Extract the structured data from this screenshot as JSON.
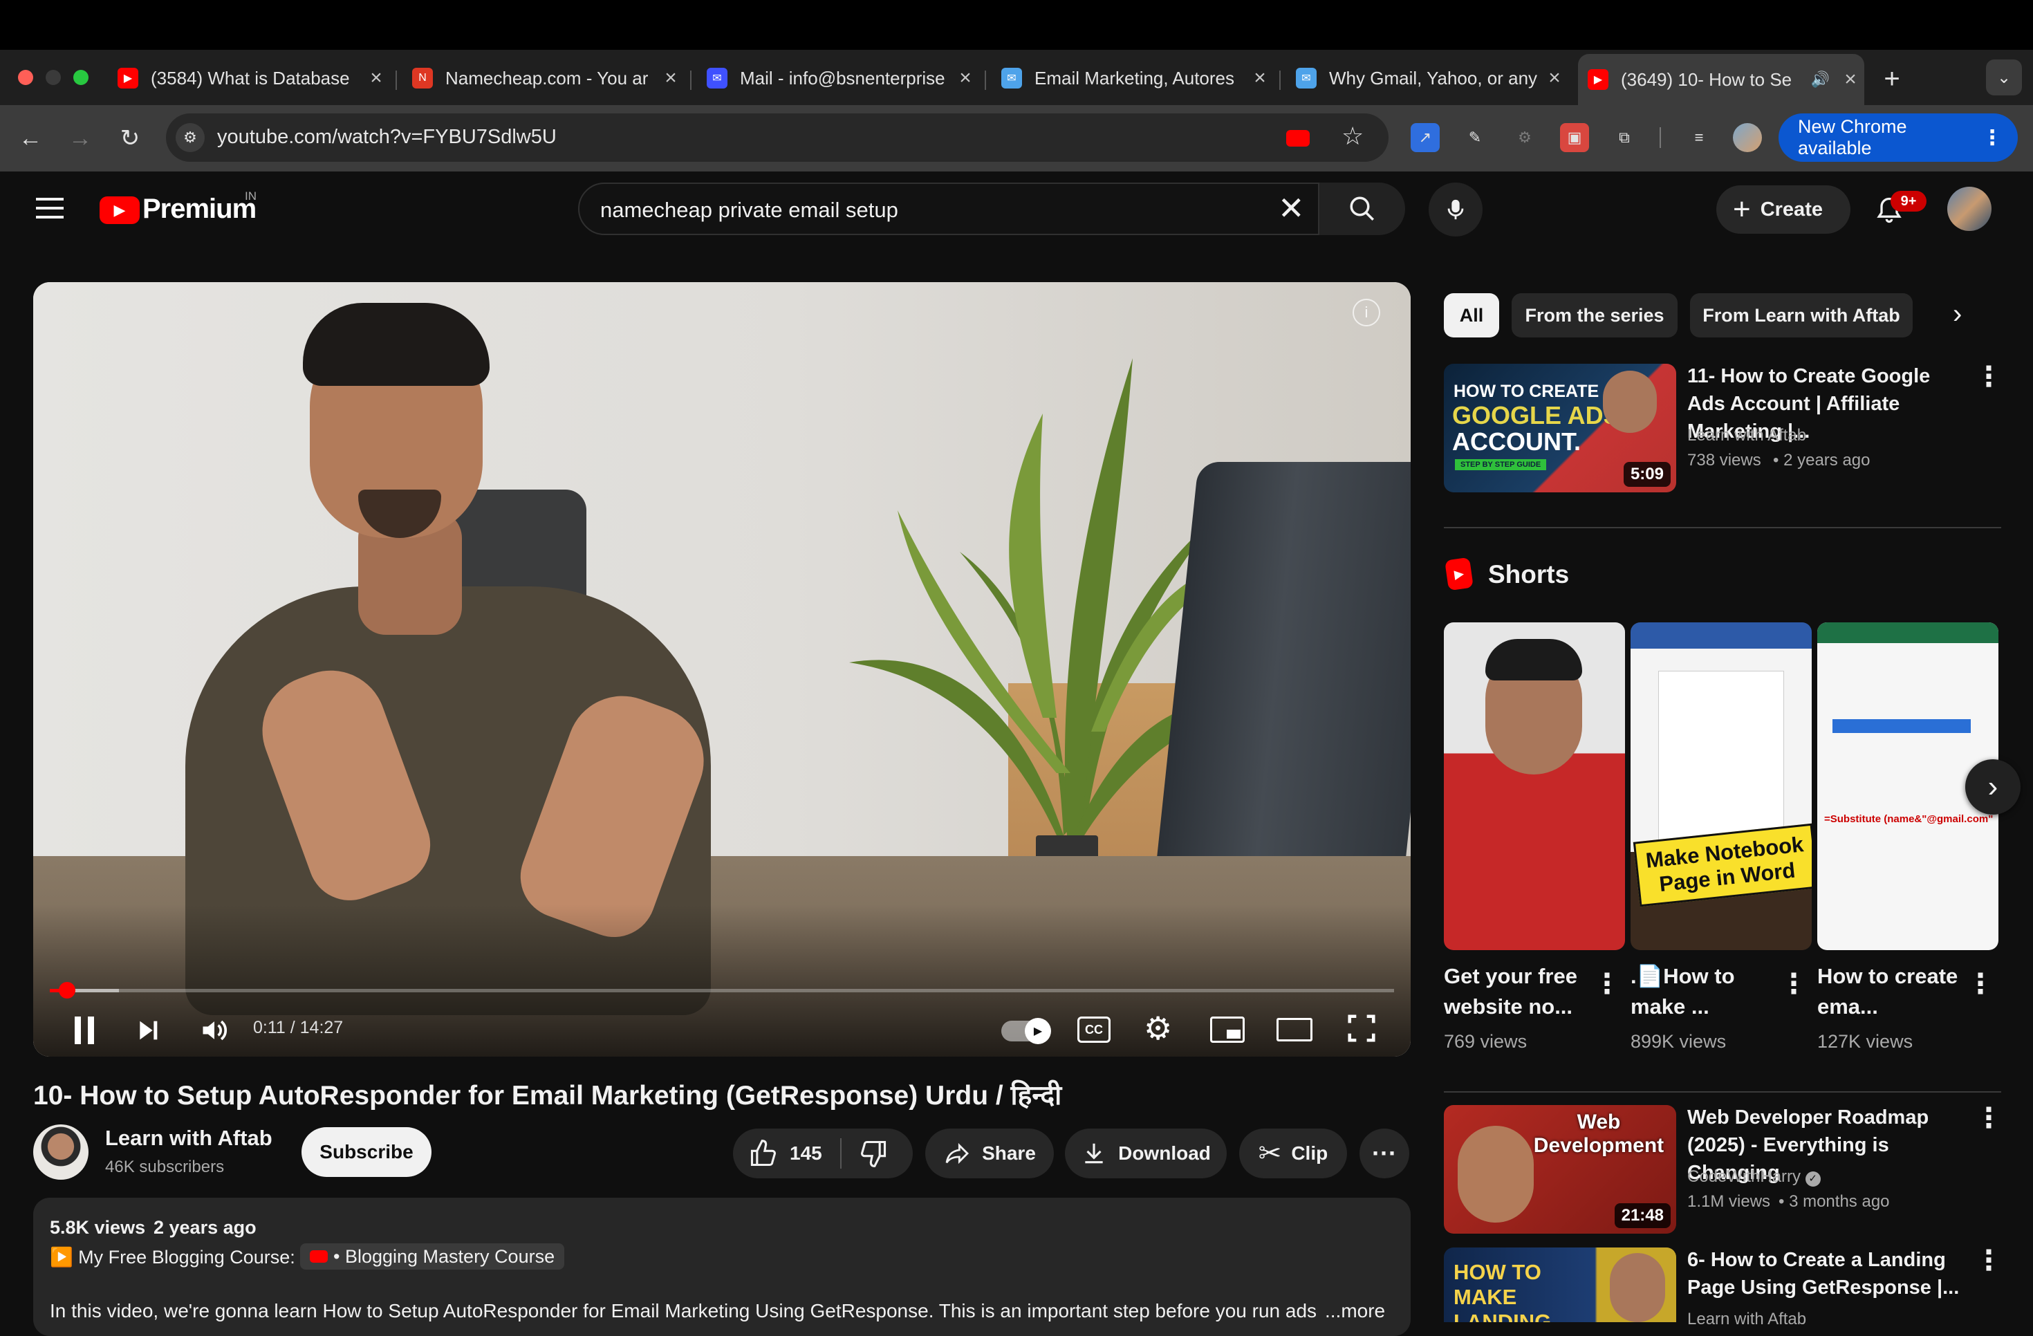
{
  "browser": {
    "tabs": [
      {
        "title": "(3584) What is Database",
        "favicon": "youtube-icon",
        "color": "#ff0000"
      },
      {
        "title": "Namecheap.com - You ar",
        "favicon": "namecheap-icon",
        "color": "#de3723"
      },
      {
        "title": "Mail - info@bsnenterprise",
        "favicon": "mail-icon",
        "color": "#3f51ff"
      },
      {
        "title": "Email Marketing, Autores",
        "favicon": "envelope-icon",
        "color": "#4ea3ea"
      },
      {
        "title": "Why Gmail, Yahoo, or any",
        "favicon": "envelope-icon",
        "color": "#4ea3ea"
      },
      {
        "title": "(3649) 10- How to Se",
        "favicon": "youtube-icon",
        "color": "#ff0000"
      }
    ],
    "url": "youtube.com/watch?v=FYBU7Sdlw5U",
    "update_label": "New Chrome available"
  },
  "yt": {
    "logo": "Premium",
    "region": "IN",
    "search_value": "namecheap private email setup",
    "create_label": "Create",
    "notif_count": "9+",
    "brand_color": "#ff0000"
  },
  "player": {
    "time": "0:11 / 14:27",
    "progress": 0.013
  },
  "video": {
    "title": "10- How to Setup AutoResponder for Email Marketing (GetResponse) Urdu / हिन्दी",
    "channel": "Learn with Aftab",
    "subscribers": "46K subscribers",
    "subscribe_label": "Subscribe",
    "likes": "145",
    "share_label": "Share",
    "download_label": "Download",
    "clip_label": "Clip",
    "views": "5.8K views",
    "age": "2 years ago",
    "course_prefix": "▶️ My Free Blogging Course:",
    "course_link": "• Blogging Mastery Course",
    "description": "In this video, we're gonna learn How to Setup AutoResponder for Email Marketing Using GetResponse. This is an important step before you run ads o",
    "more_label": "...more"
  },
  "sidebar": {
    "chips": [
      "All",
      "From the series",
      "From Learn with Aftab"
    ],
    "first_video": {
      "thumb_lines": [
        "HOW TO CREATE",
        "GOOGLE ADS",
        "ACCOUNT.",
        "STEP BY STEP GUIDE"
      ],
      "duration": "5:09",
      "title": "11- How to Create Google Ads Account | Affiliate Marketing |...",
      "channel": "Learn with Aftab",
      "views": "738 views",
      "age": "2 years ago"
    },
    "shorts_label": "Shorts",
    "shorts": [
      {
        "title": "Get your free website no...",
        "views": "769 views"
      },
      {
        "title": ".📄How to make ...",
        "views": "899K views",
        "thumb_text": "Make Notebook Page in Word"
      },
      {
        "title": "How to create ema...",
        "views": "127K views",
        "thumb_text": "=Substitute (name&\"@gmail.com\""
      }
    ],
    "videos": [
      {
        "title": "Web Developer Roadmap (2025) - Everything is Changing",
        "channel": "CodeWithHarry",
        "views": "1.1M views",
        "age": "3 months ago",
        "duration": "21:48",
        "thumb_text": "Web Development"
      },
      {
        "title": "6- How to Create a Landing Page Using GetResponse |...",
        "channel": "Learn with Aftab",
        "thumb_text": "HOW TO MAKE LANDING PAGE"
      }
    ]
  }
}
